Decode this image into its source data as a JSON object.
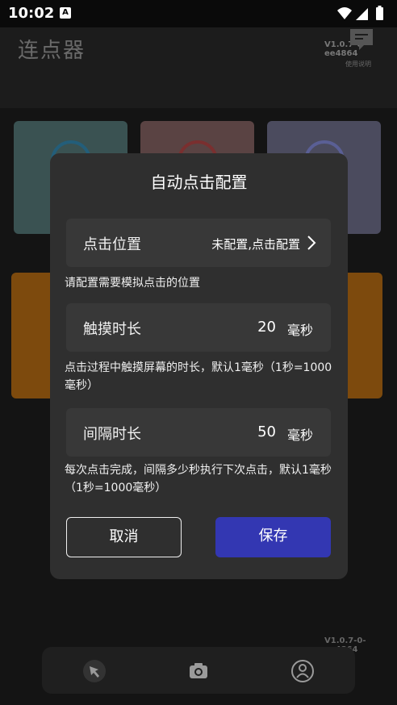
{
  "status_bar": {
    "time": "10:02",
    "notification_letter": "A"
  },
  "app": {
    "title": "连点器",
    "version": "V1.0.7-0-ee4864",
    "help_label": "使用说明"
  },
  "dialog": {
    "title": "自动点击配置",
    "click_position": {
      "label": "点击位置",
      "value": "未配置,点击配置"
    },
    "click_position_desc": "请配置需要模拟点击的位置",
    "touch_duration": {
      "label": "触摸时长",
      "value": "20",
      "unit": "毫秒"
    },
    "touch_duration_desc": "点击过程中触摸屏幕的时长，默认1毫秒（1秒=1000毫秒）",
    "interval_duration": {
      "label": "间隔时长",
      "value": "50",
      "unit": "毫秒"
    },
    "interval_duration_desc": "每次点击完成，间隔多少秒执行下次点击，默认1毫秒（1秒=1000毫秒）",
    "cancel_label": "取消",
    "save_label": "保存"
  },
  "colors": {
    "accent": "#3337b2",
    "dialog_bg": "#2f2f2f",
    "row_bg": "#383838"
  }
}
